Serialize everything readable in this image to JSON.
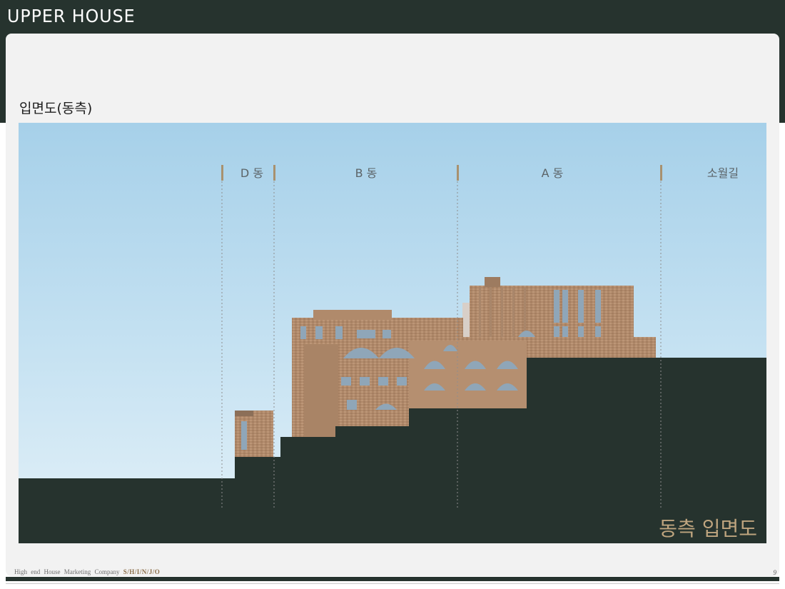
{
  "header": {
    "logo_text": "UPPER HOUSE"
  },
  "page": {
    "title": "입면도(동측)",
    "page_number": "9"
  },
  "drawing": {
    "zones": [
      {
        "label": "D 동"
      },
      {
        "label": "B 동"
      },
      {
        "label": "A 동"
      },
      {
        "label": "소월길"
      }
    ],
    "caption": "동측 입면도"
  },
  "footer": {
    "text": "High end  House  Marketing  Company ",
    "brand": "S/H/I/N/J/O"
  },
  "colors": {
    "dark_green": "#26332e",
    "sky_top": "#a8d2ea",
    "sky_bottom": "#dcedf7",
    "brick": "#b08a6b",
    "accent_tan": "#a8916f",
    "caption_color": "#bfa57f"
  }
}
